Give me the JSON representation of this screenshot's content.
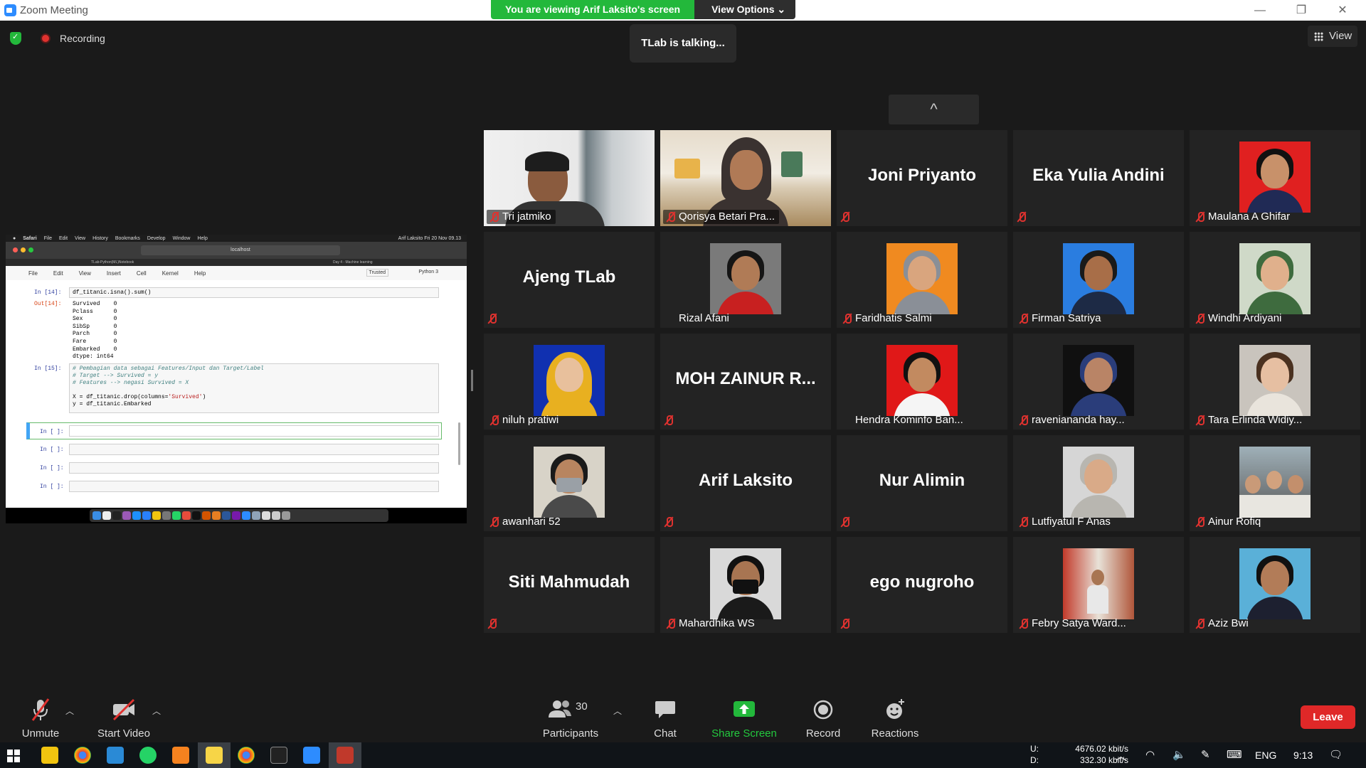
{
  "window": {
    "title": "Zoom Meeting",
    "minimize": "—",
    "restore": "❐",
    "close": "✕"
  },
  "banner": {
    "viewing": "You are viewing Arif Laksito's screen",
    "view_options": "View Options ⌄"
  },
  "talking": "TLab is talking...",
  "recording": "Recording",
  "view_button": "View",
  "scroll_up": "^",
  "shared_screen": {
    "mac_menu": [
      "Safari",
      "File",
      "Edit",
      "View",
      "History",
      "Bookmarks",
      "Develop",
      "Window",
      "Help"
    ],
    "mac_status": "Arif Laksito    Fri 20 Nov  09.13",
    "url": "localhost",
    "tab1": "TLab-Python(ML)Notebook",
    "tab2": "Day 4 - Machine learning",
    "jupyter_menu": [
      "File",
      "Edit",
      "View",
      "Insert",
      "Cell",
      "Kernel",
      "Help"
    ],
    "trusted": "Trusted",
    "kernel": "Python 3",
    "cell14_label": "In [14]:",
    "cell14_code": "df_titanic.isna().sum()",
    "out14_label": "Out[14]:",
    "out14_text": "Survived    0\nPclass      0\nSex         0\nSibSp       0\nParch       0\nFare        0\nEmbarked    0\ndtype: int64",
    "cell15_label": "In [15]:",
    "cell15_c1": "# Pembagian data sebagai Features/Input dan Target/Label",
    "cell15_c2": "# Target --> Survived = y",
    "cell15_c3": "# Features --> negasi Survived = X",
    "cell15_l4a": "X = df_titanic.drop(columns=",
    "cell15_l4s": "'Survived'",
    "cell15_l4b": ")",
    "cell15_l5": "y = df_titanic.Embarked",
    "empty_label": "In [ ]:"
  },
  "participants": [
    {
      "name": "Tri jatmiko",
      "type": "photo"
    },
    {
      "name": "Qorisya Betari Pra...",
      "type": "photo"
    },
    {
      "name": "Joni Priyanto",
      "type": "name",
      "big": "Joni Priyanto"
    },
    {
      "name": "Eka Yulia Andini",
      "type": "name",
      "big": "Eka Yulia Andini"
    },
    {
      "name": "Maulana A Ghifar",
      "type": "avatar"
    },
    {
      "name": "Ajeng TLab",
      "type": "name",
      "big": "Ajeng TLab"
    },
    {
      "name": "Rizal Afani",
      "type": "avatar"
    },
    {
      "name": "Faridhatis Salmi",
      "type": "avatar"
    },
    {
      "name": "Firman Satriya",
      "type": "avatar"
    },
    {
      "name": "Windhi Ardiyani",
      "type": "avatar"
    },
    {
      "name": "niluh pratiwi",
      "type": "avatar"
    },
    {
      "name": "MOH ZAINUR R...",
      "type": "name",
      "big": "MOH ZAINUR R..."
    },
    {
      "name": "Hendra Kominfo Ban...",
      "type": "avatar"
    },
    {
      "name": "raveniananda hay...",
      "type": "avatar"
    },
    {
      "name": "Tara Erlinda Widiy...",
      "type": "avatar"
    },
    {
      "name": "awanhari 52",
      "type": "avatar"
    },
    {
      "name": "Arif Laksito",
      "type": "name",
      "big": "Arif Laksito"
    },
    {
      "name": "Nur Alimin",
      "type": "name",
      "big": "Nur Alimin"
    },
    {
      "name": "Lutfiyatul F Anas",
      "type": "avatar"
    },
    {
      "name": "Ainur Rofiq",
      "type": "avatar"
    },
    {
      "name": "Siti Mahmudah",
      "type": "name",
      "big": "Siti Mahmudah"
    },
    {
      "name": "Mahardhika WS",
      "type": "avatar"
    },
    {
      "name": "ego nugroho",
      "type": "name",
      "big": "ego nugroho"
    },
    {
      "name": "Febry Satya Ward...",
      "type": "avatar"
    },
    {
      "name": "Aziz Bwi",
      "type": "avatar"
    }
  ],
  "controls": {
    "unmute": "Unmute",
    "start_video": "Start Video",
    "participants_count": "30",
    "participants": "Participants",
    "chat": "Chat",
    "share_screen": "Share Screen",
    "record": "Record",
    "reactions": "Reactions",
    "leave": "Leave"
  },
  "taskbar": {
    "upload": "U:",
    "upload_rate": "4676.02 kbit/s",
    "download": "D:",
    "download_rate": "332.30 kbit/s",
    "language": "ENG",
    "clock": "9:13"
  },
  "colors": {
    "zoom_blue": "#2d8cff",
    "banner_green": "#23b83b",
    "leave_red": "#e02828",
    "mute_red": "#e0322f"
  }
}
